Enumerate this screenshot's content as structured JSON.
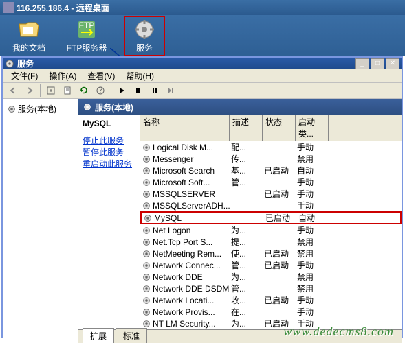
{
  "remote": {
    "ip": "116.255.186.4",
    "title_suffix": "远程桌面"
  },
  "desktop_icons": [
    {
      "label": "我的文档",
      "icon": "folder"
    },
    {
      "label": "FTP服务器",
      "icon": "ftp"
    },
    {
      "label": "服务",
      "icon": "gear",
      "selected": true
    }
  ],
  "mmc": {
    "title": "服务",
    "menus": [
      "文件(F)",
      "操作(A)",
      "查看(V)",
      "帮助(H)"
    ],
    "tree_root": "服务(本地)",
    "panel_title": "服务(本地)",
    "selected_service": "MySQL",
    "actions": {
      "stop": "停止此服务",
      "pause": "暂停此服务",
      "restart": "重启动此服务"
    },
    "columns": {
      "name": "名称",
      "desc": "描述",
      "status": "状态",
      "startup": "启动类..."
    },
    "tabs": {
      "extended": "扩展",
      "standard": "标准"
    }
  },
  "services": [
    {
      "name": "Logical Disk M...",
      "desc": "配...",
      "status": "",
      "startup": "手动"
    },
    {
      "name": "Messenger",
      "desc": "传...",
      "status": "",
      "startup": "禁用"
    },
    {
      "name": "Microsoft Search",
      "desc": "基...",
      "status": "已启动",
      "startup": "自动"
    },
    {
      "name": "Microsoft Soft...",
      "desc": "管...",
      "status": "",
      "startup": "手动"
    },
    {
      "name": "MSSQLSERVER",
      "desc": "",
      "status": "已启动",
      "startup": "手动"
    },
    {
      "name": "MSSQLServerADH...",
      "desc": "",
      "status": "",
      "startup": "手动"
    },
    {
      "name": "MySQL",
      "desc": "",
      "status": "已启动",
      "startup": "自动",
      "highlight": true
    },
    {
      "name": "Net Logon",
      "desc": "为...",
      "status": "",
      "startup": "手动"
    },
    {
      "name": "Net.Tcp Port S...",
      "desc": "提...",
      "status": "",
      "startup": "禁用"
    },
    {
      "name": "NetMeeting Rem...",
      "desc": "使...",
      "status": "已启动",
      "startup": "禁用"
    },
    {
      "name": "Network Connec...",
      "desc": "管...",
      "status": "已启动",
      "startup": "手动"
    },
    {
      "name": "Network DDE",
      "desc": "为...",
      "status": "",
      "startup": "禁用"
    },
    {
      "name": "Network DDE DSDM",
      "desc": "管...",
      "status": "",
      "startup": "禁用"
    },
    {
      "name": "Network Locati...",
      "desc": "收...",
      "status": "已启动",
      "startup": "手动"
    },
    {
      "name": "Network Provis...",
      "desc": "在...",
      "status": "",
      "startup": "手动"
    },
    {
      "name": "NT LM Security...",
      "desc": "为...",
      "status": "已启动",
      "startup": "手动"
    }
  ],
  "watermark": "www.dedecms8.com"
}
